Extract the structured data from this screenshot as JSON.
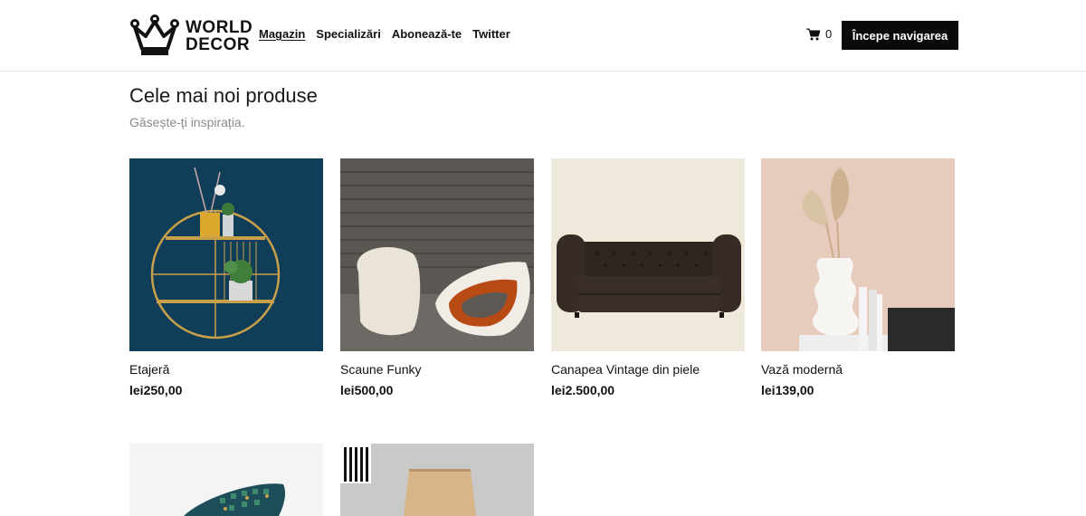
{
  "header": {
    "logo": {
      "line1": "WORLD",
      "line2": "DECOR",
      "icon": "crown-icon"
    },
    "nav": [
      {
        "label": "Magazin",
        "active": true
      },
      {
        "label": "Specializări",
        "active": false
      },
      {
        "label": "Abonează-te",
        "active": false
      },
      {
        "label": "Twitter",
        "active": false
      }
    ],
    "cart": {
      "icon": "cart-icon",
      "count": "0"
    },
    "cta_label": "Începe navigarea"
  },
  "section": {
    "title": "Cele mai noi produse",
    "subtitle": "Găsește-ți inspirația."
  },
  "products": [
    {
      "name": "Etajeră",
      "price": "lei250,00"
    },
    {
      "name": "Scaune Funky",
      "price": "lei500,00"
    },
    {
      "name": "Canapea Vintage din piele",
      "price": "lei2.500,00"
    },
    {
      "name": "Vază modernă",
      "price": "lei139,00"
    },
    {
      "name": "",
      "price": ""
    },
    {
      "name": "",
      "price": ""
    }
  ],
  "colors": {
    "accent": "#0a0a0a",
    "border": "#e3e3e3",
    "muted": "#8a8a8a"
  }
}
